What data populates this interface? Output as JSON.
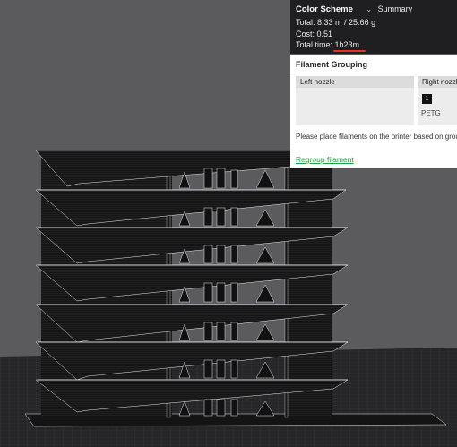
{
  "summary": {
    "title": "Color Scheme",
    "view_selected": "Summary",
    "total_label": "Total:",
    "total_value": "8.33 m / 25.66 g",
    "cost_label": "Cost:",
    "cost_value": "0.51",
    "time_label": "Total time:",
    "time_value": "1h23m"
  },
  "grouping": {
    "title": "Filament Grouping",
    "left_nozzle_label": "Left nozzle",
    "right_nozzle_label": "Right nozzle",
    "slot_number": "1",
    "slot_material": "PETG",
    "hint": "Please place filaments on the printer based on grouping",
    "regroup_link": "Regroup filament"
  },
  "colors": {
    "viewport_bg": "#5b5b5e",
    "panel_dark": "#1f1f21",
    "accent_green": "#1ea24a",
    "underline_red": "#e0332e",
    "model_color": "#141414"
  }
}
